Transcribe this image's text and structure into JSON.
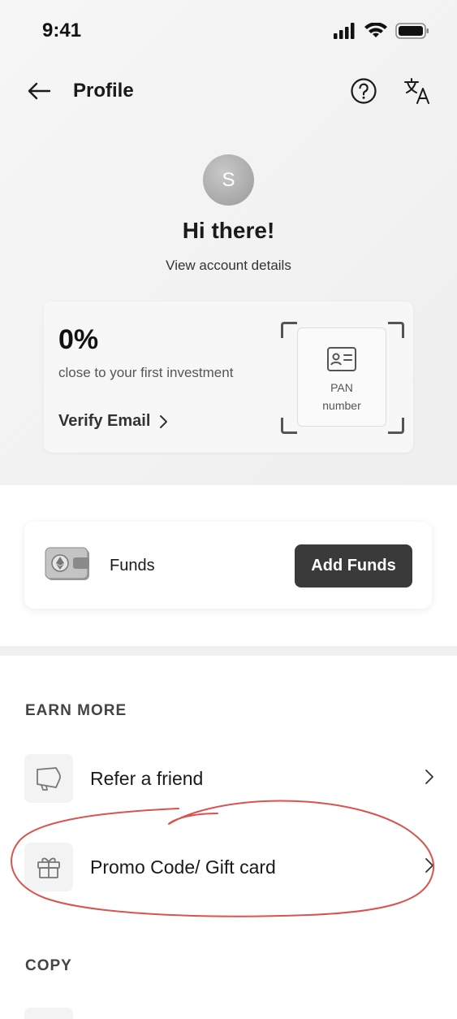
{
  "status_bar": {
    "time": "9:41"
  },
  "header": {
    "title": "Profile"
  },
  "profile": {
    "avatar_initial": "S",
    "greeting": "Hi there!",
    "view_details": "View account details"
  },
  "progress_card": {
    "percent": "0%",
    "subtitle": "close to your first investment",
    "action_label": "Verify Email",
    "pan_label": "PAN\nnumber"
  },
  "funds": {
    "label": "Funds",
    "button_label": "Add Funds"
  },
  "earn_more": {
    "title": "EARN MORE",
    "items": [
      {
        "label": "Refer a friend",
        "icon": "megaphone-icon"
      },
      {
        "label": "Promo Code/ Gift card",
        "icon": "gift-icon"
      }
    ]
  },
  "copy_section": {
    "title": "COPY"
  },
  "colors": {
    "button_dark": "#3a3a3a",
    "annotation_red": "#d9534f"
  }
}
